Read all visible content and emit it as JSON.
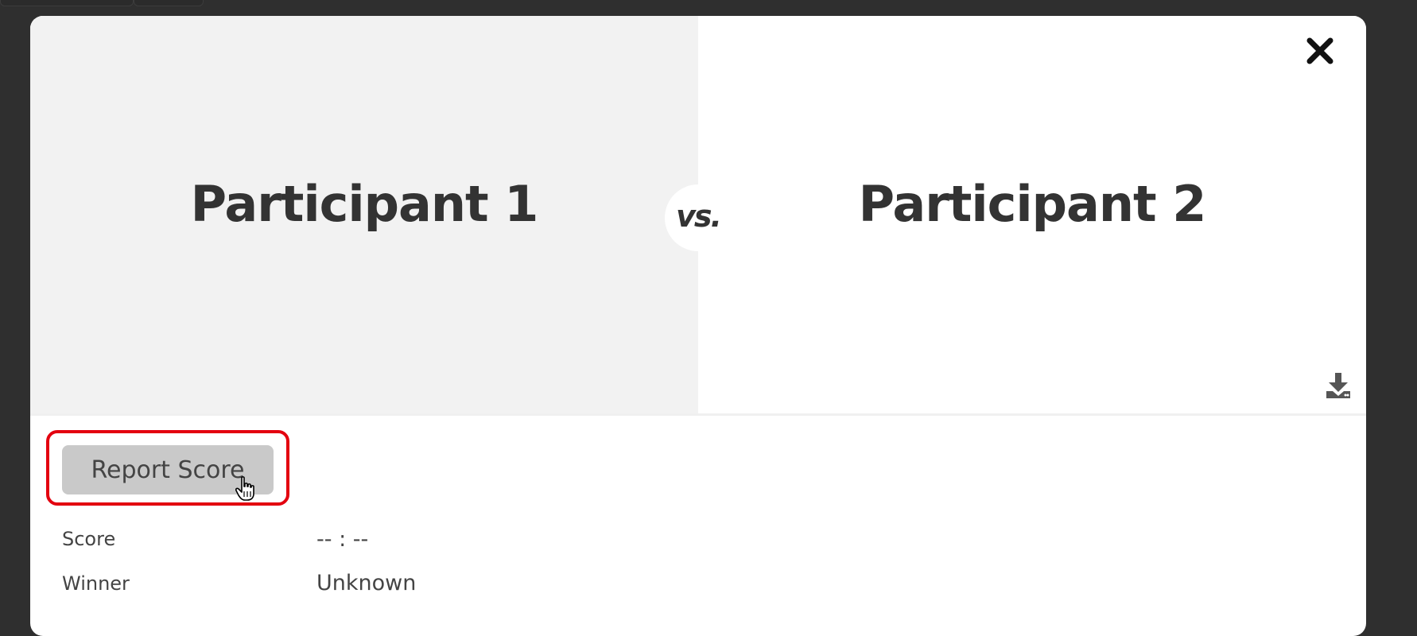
{
  "match": {
    "participant1": "Participant 1",
    "vs_label": "vs.",
    "participant2": "Participant 2"
  },
  "actions": {
    "report_score_label": "Report Score"
  },
  "details": [
    {
      "label": "Score",
      "value": "-- : --"
    },
    {
      "label": "Winner",
      "value": "Unknown"
    }
  ],
  "icons": {
    "close": "close-icon",
    "download": "download-icon",
    "pointer": "hand-cursor-icon"
  },
  "colors": {
    "backdrop": "#2f2f2f",
    "left_panel": "#f2f2f2",
    "text": "#333333",
    "button_bg": "#c9c9c9",
    "highlight": "#e3000f"
  }
}
